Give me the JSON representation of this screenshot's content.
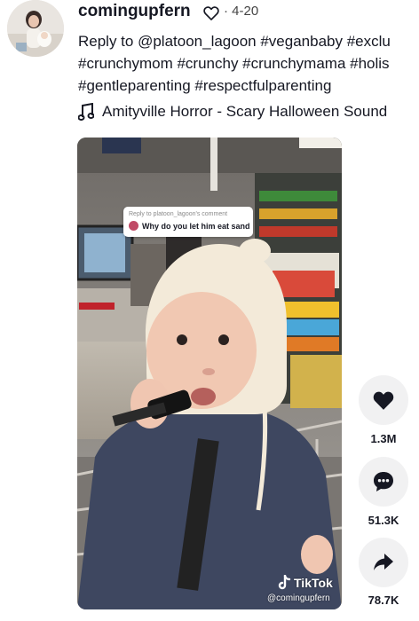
{
  "post": {
    "username": "comingupfern",
    "date": "4-20",
    "caption_lines": [
      "Reply to @platoon_lagoon #veganbaby #exclu",
      "#crunchymom #crunchy #crunchymama #holis",
      "#gentleparenting #respectfulparenting"
    ],
    "sound": "Amityville Horror - Scary Halloween Sound"
  },
  "video": {
    "reply_header": "Reply to platoon_lagoon's comment",
    "comment_text": "Why do you let him eat sand",
    "watermark_brand": "TikTok",
    "watermark_handle": "@comingupfern"
  },
  "actions": {
    "likes": "1.3M",
    "comments": "51.3K",
    "shares": "78.7K"
  },
  "icons": {
    "like": "heart-icon",
    "comment": "comment-bubble-icon",
    "share": "share-arrow-icon",
    "sound": "music-note-icon"
  }
}
